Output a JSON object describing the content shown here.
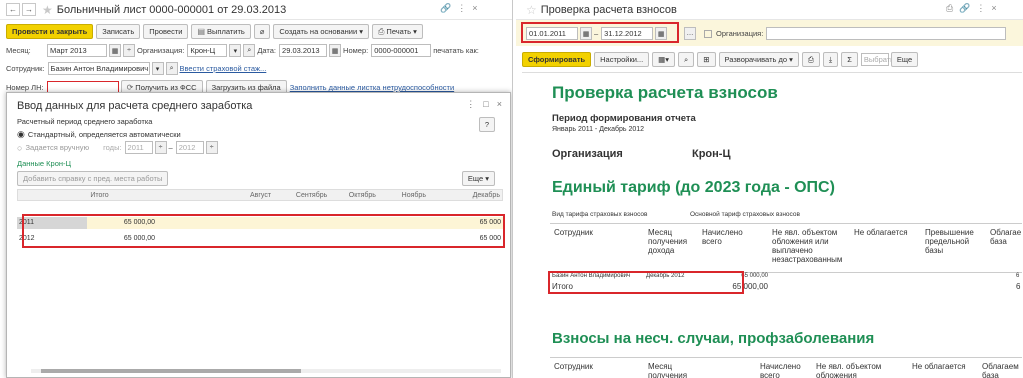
{
  "left": {
    "title": "Больничный лист 0000-000001 от 29.03.2013",
    "toolbar": {
      "post_close": "Провести и закрыть",
      "save": "Записать",
      "post": "Провести",
      "pay": "Выплатить",
      "create_basis": "Создать на основании",
      "print": "Печать"
    },
    "month_label": "Месяц:",
    "month_value": "Март 2013",
    "org_label": "Организация:",
    "org_value": "Крон-Ц",
    "date_label": "Дата:",
    "date_value": "29.03.2013",
    "number_label": "Номер:",
    "number_value": "0000-000001",
    "print_as_label": "печатать как:",
    "employee_label": "Сотрудник:",
    "employee_value": "Базин Антон Владимирович",
    "insurance_link": "Ввести страховой стаж...",
    "sick_no_label": "Номер ЛН:",
    "get_fss": "Получить из ФСС",
    "load_file": "Загрузить из файла",
    "fill_data_link": "Заполнить данные листка нетрудоспособности"
  },
  "modal": {
    "title": "Ввод данных для расчета среднего заработка",
    "period_label": "Расчетный период среднего заработка",
    "opt_standard": "Стандартный, определяется автоматически",
    "opt_manual": "Задается вручную",
    "years_label": "годы:",
    "year_from": "2011",
    "year_to": "2012",
    "dash": "–",
    "company_label": "Данные Крон-Ц",
    "add_cert_button": "Добавить справку с пред. места работы",
    "more_button": "Еще",
    "help": "?",
    "columns": [
      "",
      "Итого",
      "Август",
      "Сентябрь",
      "Октябрь",
      "Ноябрь",
      "Декабрь"
    ],
    "rows": [
      {
        "year": "2011",
        "total": "65 000,00",
        "dec": "65 000"
      },
      {
        "year": "2012",
        "total": "65 000,00",
        "dec": "65 000"
      }
    ]
  },
  "right": {
    "title": "Проверка расчета взносов",
    "date_from": "01.01.2011",
    "date_to": "31.12.2012",
    "org_label": "Организация:",
    "generate": "Сформировать",
    "settings": "Настройки...",
    "expand": "Разворачивать до",
    "more": "Еще",
    "select_hint": "Выбрать",
    "report_title": "Проверка расчета взносов",
    "period_label": "Период формирования отчета",
    "period_value": "Январь 2011 - Декабрь 2012",
    "org_caption": "Организация",
    "org_value": "Крон-Ц",
    "section1": "Единый тариф (до 2023 года - ОПС)",
    "tariff_label": "Вид тарифа страховых взносов",
    "tariff_value": "Основной тариф страховых взносов",
    "cols1": [
      "Сотрудник",
      "Месяц получения дохода",
      "Начислено всего",
      "Не явл. объектом обложения или выплачено незастрахованным",
      "Не облагается",
      "Превышение предельной базы",
      "Облагае база"
    ],
    "emp_row": {
      "name": "Базин Антон Владимирович",
      "month": "Декабрь 2012",
      "amount": "65 000,00"
    },
    "total_row": {
      "label": "Итого",
      "amount": "65 000,00",
      "tail": "6"
    },
    "emp_tail": "6",
    "section2": "Взносы на несч. случаи, профзаболевания",
    "cols2": [
      "Сотрудник",
      "Месяц получения",
      "Начислено всего",
      "Не явл. объектом обложения",
      "Не облагается",
      "Облагаем база"
    ]
  }
}
